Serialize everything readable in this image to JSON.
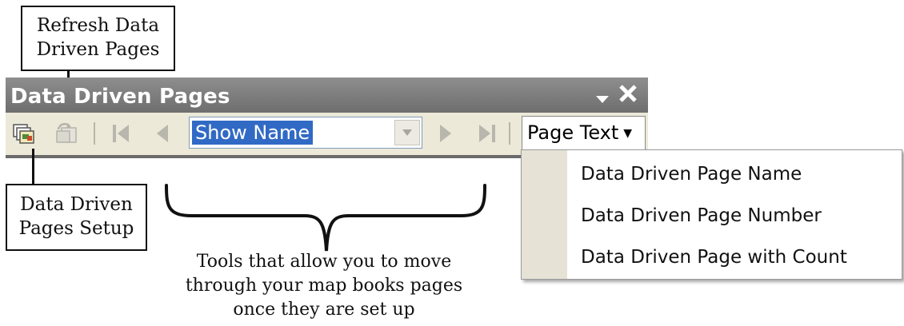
{
  "callouts": {
    "refresh": {
      "line1": "Refresh Data",
      "line2": "Driven Pages"
    },
    "setup": {
      "line1": "Data Driven",
      "line2": "Pages Setup"
    }
  },
  "toolbar": {
    "title": "Data Driven Pages",
    "page_name_value": "Show Name",
    "page_text_label": "Page Text"
  },
  "dropdown": {
    "items": [
      "Data Driven Page Name",
      "Data Driven Page Number",
      "Data Driven Page with Count"
    ]
  },
  "caption": {
    "line1": "Tools that allow you to move",
    "line2": "through your map books pages",
    "line3": "once they are set up"
  },
  "colors": {
    "titlebar": "#7a7a7a",
    "toolbar_bg": "#ece9d8",
    "selection": "#316ac5"
  },
  "icons": [
    "setup-icon",
    "refresh-icon",
    "first-page-icon",
    "previous-page-icon",
    "next-page-icon",
    "last-page-icon",
    "dropdown-arrow-icon",
    "menu-arrow-icon",
    "close-icon"
  ]
}
